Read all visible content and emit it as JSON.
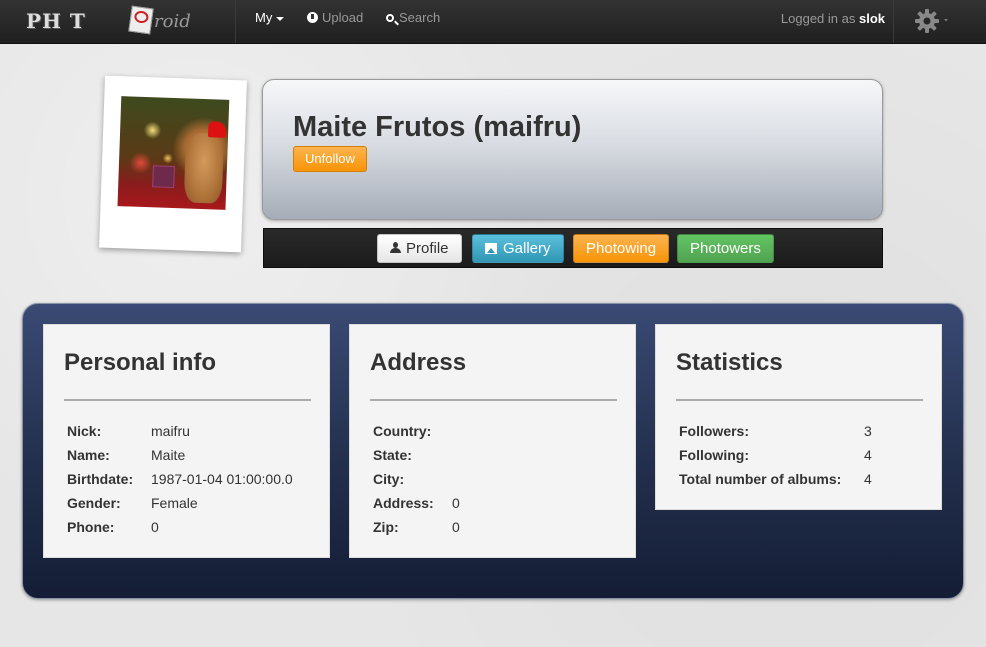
{
  "navbar": {
    "brand": {
      "photo_text": "PH  T",
      "roid_text": "roid"
    },
    "my_label": "My",
    "upload_label": "Upload",
    "search_label": "Search",
    "logged_in_prefix": "Logged in as",
    "username": "slok"
  },
  "profile": {
    "display_name": "Maite Frutos (maifru)",
    "unfollow_label": "Unfollow",
    "tabs": [
      {
        "label": "Profile",
        "icon": "user-icon"
      },
      {
        "label": "Gallery",
        "icon": "picture-icon"
      },
      {
        "label": "Photowing"
      },
      {
        "label": "Photowers"
      }
    ]
  },
  "personal_info": {
    "title": "Personal info",
    "rows": [
      {
        "key": "Nick:",
        "value": "maifru"
      },
      {
        "key": "Name:",
        "value": "Maite"
      },
      {
        "key": "Birthdate:",
        "value": "1987-01-04 01:00:00.0"
      },
      {
        "key": "Gender:",
        "value": "Female"
      },
      {
        "key": "Phone:",
        "value": "0"
      }
    ]
  },
  "address": {
    "title": "Address",
    "rows": [
      {
        "key": "Country:",
        "value": ""
      },
      {
        "key": "State:",
        "value": ""
      },
      {
        "key": "City:",
        "value": ""
      },
      {
        "key": "Address:",
        "value": "0"
      },
      {
        "key": "Zip:",
        "value": "0"
      }
    ]
  },
  "statistics": {
    "title": "Statistics",
    "rows": [
      {
        "key": "Followers:",
        "value": "3"
      },
      {
        "key": "Following:",
        "value": "4"
      },
      {
        "key": "Total number of albums:",
        "value": "4"
      }
    ]
  },
  "colors": {
    "navbar": "#222222",
    "orange": "#f89406",
    "info": "#2f96b4",
    "success": "#51a351",
    "panel": "#24314f"
  }
}
